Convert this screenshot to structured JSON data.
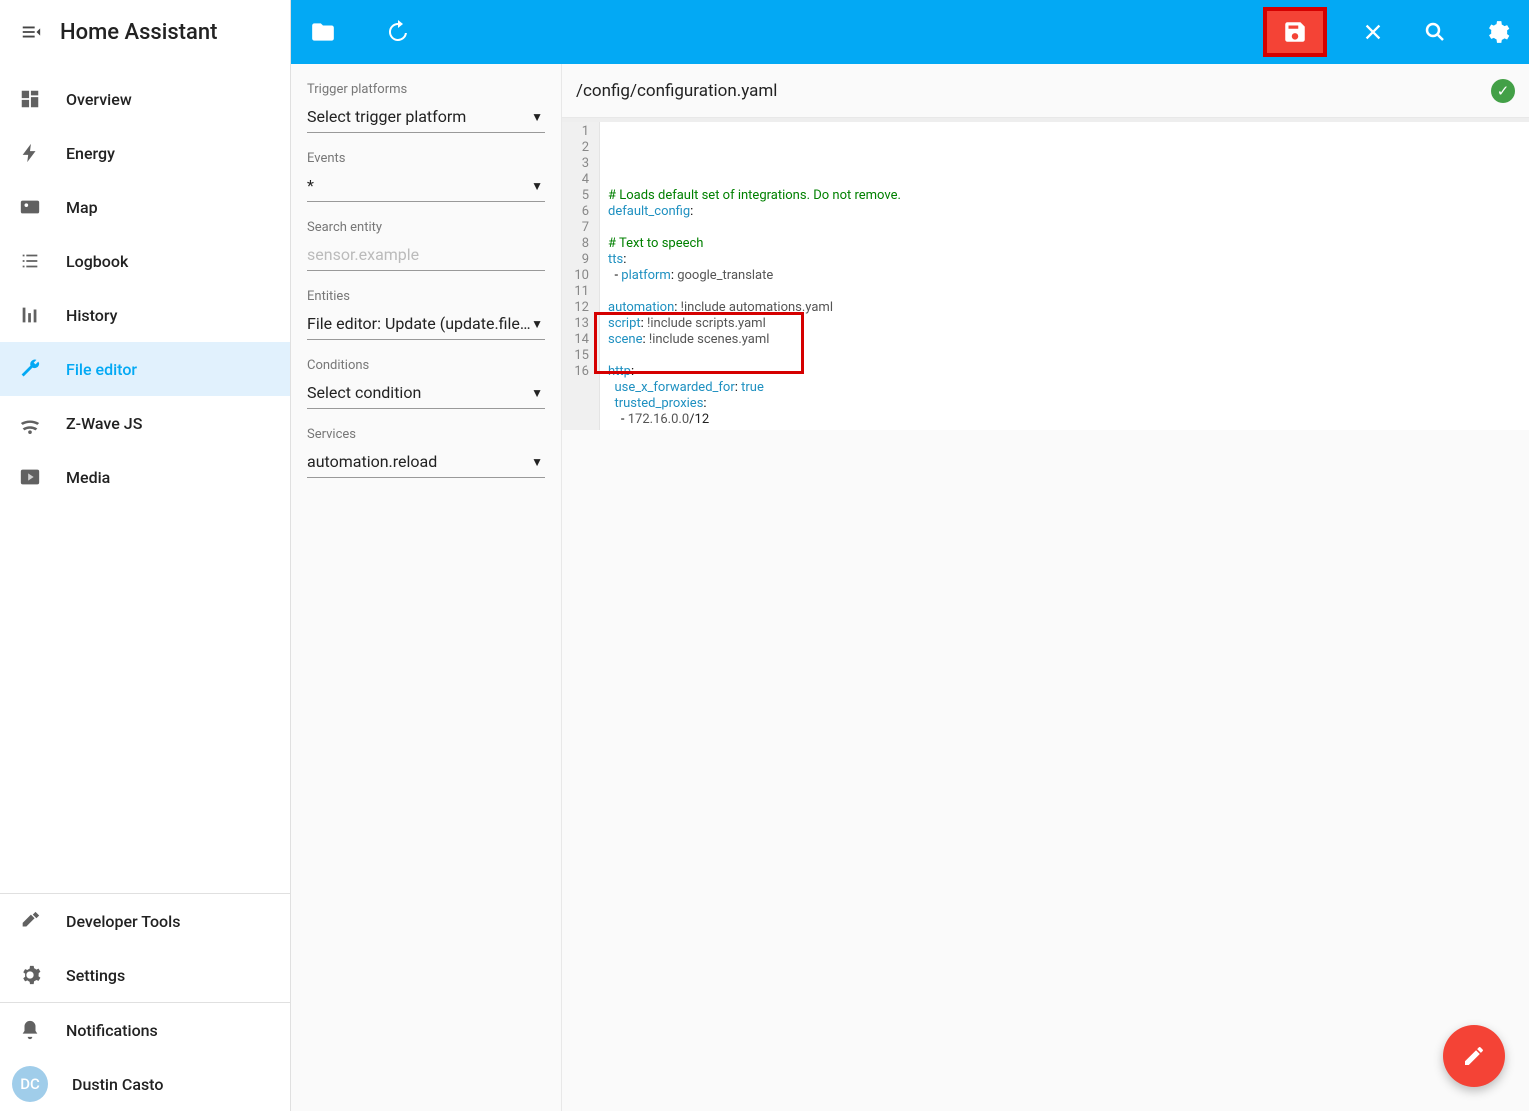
{
  "app_title": "Home Assistant",
  "sidebar": {
    "items": [
      {
        "id": "overview",
        "label": "Overview",
        "icon": "dashboard-icon"
      },
      {
        "id": "energy",
        "label": "Energy",
        "icon": "bolt-icon"
      },
      {
        "id": "map",
        "label": "Map",
        "icon": "map-icon"
      },
      {
        "id": "logbook",
        "label": "Logbook",
        "icon": "list-icon"
      },
      {
        "id": "history",
        "label": "History",
        "icon": "chart-icon"
      },
      {
        "id": "file-editor",
        "label": "File editor",
        "icon": "wrench-icon",
        "active": true
      },
      {
        "id": "zwave",
        "label": "Z-Wave JS",
        "icon": "zwave-icon"
      },
      {
        "id": "media",
        "label": "Media",
        "icon": "play-icon"
      }
    ],
    "bottom": [
      {
        "id": "dev-tools",
        "label": "Developer Tools",
        "icon": "hammer-icon"
      },
      {
        "id": "settings",
        "label": "Settings",
        "icon": "gear-icon"
      }
    ],
    "notifications_label": "Notifications",
    "user_initials": "DC",
    "user_name": "Dustin Casto"
  },
  "side_panel": {
    "trigger_platforms_label": "Trigger platforms",
    "trigger_platforms_value": "Select trigger platform",
    "events_label": "Events",
    "events_value": "*",
    "search_entity_label": "Search entity",
    "search_entity_placeholder": "sensor.example",
    "entities_label": "Entities",
    "entities_value": "File editor: Update (update.file_ed...",
    "conditions_label": "Conditions",
    "conditions_value": "Select condition",
    "services_label": "Services",
    "services_value": "automation.reload"
  },
  "editor": {
    "file_path": "/config/configuration.yaml",
    "lines": [
      {
        "n": 1,
        "html": ""
      },
      {
        "n": 2,
        "html": "<span class='c-comment'># Loads default set of integrations. Do not remove.</span>"
      },
      {
        "n": 3,
        "html": "<span class='c-key'>default_config</span>:"
      },
      {
        "n": 4,
        "html": ""
      },
      {
        "n": 5,
        "html": "<span class='c-comment'># Text to speech</span>"
      },
      {
        "n": 6,
        "html": "<span class='c-key'>tts</span>:"
      },
      {
        "n": 7,
        "html": "  - <span class='c-key'>platform</span>: <span class='c-val'>google_translate</span>"
      },
      {
        "n": 8,
        "html": ""
      },
      {
        "n": 9,
        "html": "<span class='c-key'>automation</span>: <span class='c-val'>!include automations.yaml</span>"
      },
      {
        "n": 10,
        "html": "<span class='c-key'>script</span>: <span class='c-val'>!include scripts.yaml</span>"
      },
      {
        "n": 11,
        "html": "<span class='c-key'>scene</span>: <span class='c-val'>!include scenes.yaml</span>"
      },
      {
        "n": 12,
        "html": ""
      },
      {
        "n": 13,
        "html": "<span class='c-key'>http</span>:"
      },
      {
        "n": 14,
        "html": "  <span class='c-key'>use_x_forwarded_for</span>: <span class='c-bool'>true</span>"
      },
      {
        "n": 15,
        "html": "  <span class='c-key'>trusted_proxies</span>:"
      },
      {
        "n": 16,
        "html": "    - <span class='c-val'>172.16.0.0</span><span class='c-num'>/12</span>"
      }
    ]
  }
}
